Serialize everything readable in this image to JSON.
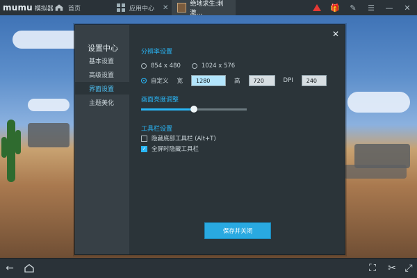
{
  "app": {
    "brand": "mumu",
    "brand_sub": "模拟器"
  },
  "tabs": [
    {
      "label": "首页"
    },
    {
      "label": "应用中心"
    },
    {
      "label": "绝地求生:刺激..."
    }
  ],
  "settings": {
    "sidebar_title": "设置中心",
    "menu": [
      {
        "label": "基本设置"
      },
      {
        "label": "高级设置"
      },
      {
        "label": "界面设置"
      },
      {
        "label": "主题美化"
      }
    ],
    "resolution": {
      "title": "分辨率设置",
      "options": [
        {
          "label": "854 x 480"
        },
        {
          "label": "1024 x 576"
        },
        {
          "label": "自定义"
        }
      ],
      "selected": "自定义",
      "fields": {
        "width_label": "宽",
        "width_value": "1280",
        "height_label": "高",
        "height_value": "720",
        "dpi_label": "DPI",
        "dpi_value": "240"
      }
    },
    "brightness": {
      "title": "画面亮度调整",
      "level": 0.5
    },
    "toolbar": {
      "title": "工具栏设置",
      "options": [
        {
          "label": "隐藏底部工具栏 (Alt+T)",
          "checked": false
        },
        {
          "label": "全屏时隐藏工具栏",
          "checked": true
        }
      ]
    },
    "save_label": "保存并关闭",
    "close_symbol": "✕"
  },
  "colors": {
    "accent": "#29b6f6",
    "panel": "#2b3439",
    "sidebar": "#374046"
  }
}
